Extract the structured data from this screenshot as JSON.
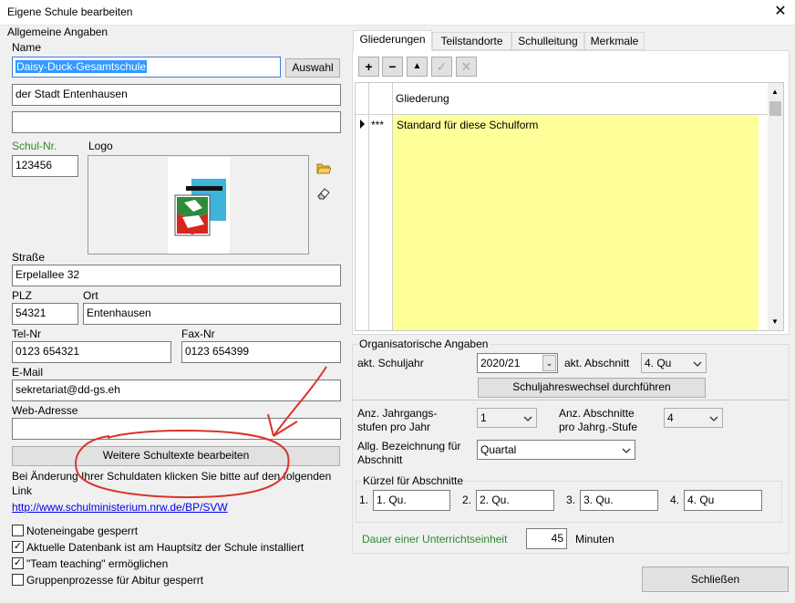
{
  "window": {
    "title": "Eigene Schule bearbeiten"
  },
  "general": {
    "group_title": "Allgemeine Angaben",
    "name_label": "Name",
    "name_value": "Daisy-Duck-Gesamtschule",
    "select_button": "Auswahl",
    "name2_value": "der Stadt Entenhausen",
    "name3_value": "",
    "school_nr_label": "Schul-Nr.",
    "school_nr_value": "123456",
    "logo_label": "Logo",
    "street_label": "Straße",
    "street_value": "Erpelallee 32",
    "zip_label": "PLZ",
    "zip_value": "54321",
    "city_label": "Ort",
    "city_value": "Entenhausen",
    "tel_label": "Tel-Nr",
    "tel_value": "0123 654321",
    "fax_label": "Fax-Nr",
    "fax_value": "0123 654399",
    "email_label": "E-Mail",
    "email_value": "sekretariat@dd-gs.eh",
    "web_label": "Web-Adresse",
    "web_value": "",
    "more_texts_button": "Weitere Schultexte bearbeiten",
    "info_text": "Bei Änderung Ihrer Schuldaten klicken Sie bitte auf den folgenden Link",
    "link_text": "http://www.schulministerium.nrw.de/BP/SVW",
    "checkboxes": [
      {
        "label": "Noteneingabe gesperrt",
        "checked": false
      },
      {
        "label": "Aktuelle Datenbank ist am Hauptsitz der Schule installiert",
        "checked": true
      },
      {
        "label": "\"Team teaching\" ermöglichen",
        "checked": true
      },
      {
        "label": "Gruppenprozesse für Abitur gesperrt",
        "checked": false
      }
    ]
  },
  "tabs": [
    {
      "label": "Gliederungen",
      "active": true
    },
    {
      "label": "Teilstandorte",
      "active": false
    },
    {
      "label": "Schulleitung",
      "active": false
    },
    {
      "label": "Merkmale",
      "active": false
    }
  ],
  "grid": {
    "column_header": "Gliederung",
    "row_marker": "***",
    "rows": [
      "Standard für diese Schulform"
    ]
  },
  "org": {
    "group_title": "Organisatorische Angaben",
    "school_year_label": "akt. Schuljahr",
    "school_year_value": "2020/21",
    "section_label": "akt. Abschnitt",
    "section_value": "4. Qu",
    "year_change_button": "Schuljahreswechsel durchführen",
    "grade_levels_label": "Anz. Jahrgangs-\nstufen pro Jahr",
    "grade_levels_value": "1",
    "sections_count_label": "Anz. Abschnitte\npro Jahrg.-Stufe",
    "sections_count_value": "4",
    "section_name_label": "Allg. Bezeichnung für\nAbschnitt",
    "section_name_value": "Quartal",
    "abbrev_group_title": "Kürzel für Abschnitte",
    "abbreviations": [
      {
        "num": "1.",
        "value": "1. Qu."
      },
      {
        "num": "2.",
        "value": "2. Qu."
      },
      {
        "num": "3.",
        "value": "3. Qu."
      },
      {
        "num": "4.",
        "value": "4. Qu"
      }
    ],
    "lesson_duration_label": "Dauer einer Unterrichtseinheit",
    "lesson_duration_value": "45",
    "minutes_label": "Minuten"
  },
  "close_button": "Schließen",
  "colors": {
    "accent_green": "#2f8a2f",
    "grid_yellow": "#ffff99",
    "selection_blue": "#3399ff",
    "annotation_red": "#d9342b"
  }
}
